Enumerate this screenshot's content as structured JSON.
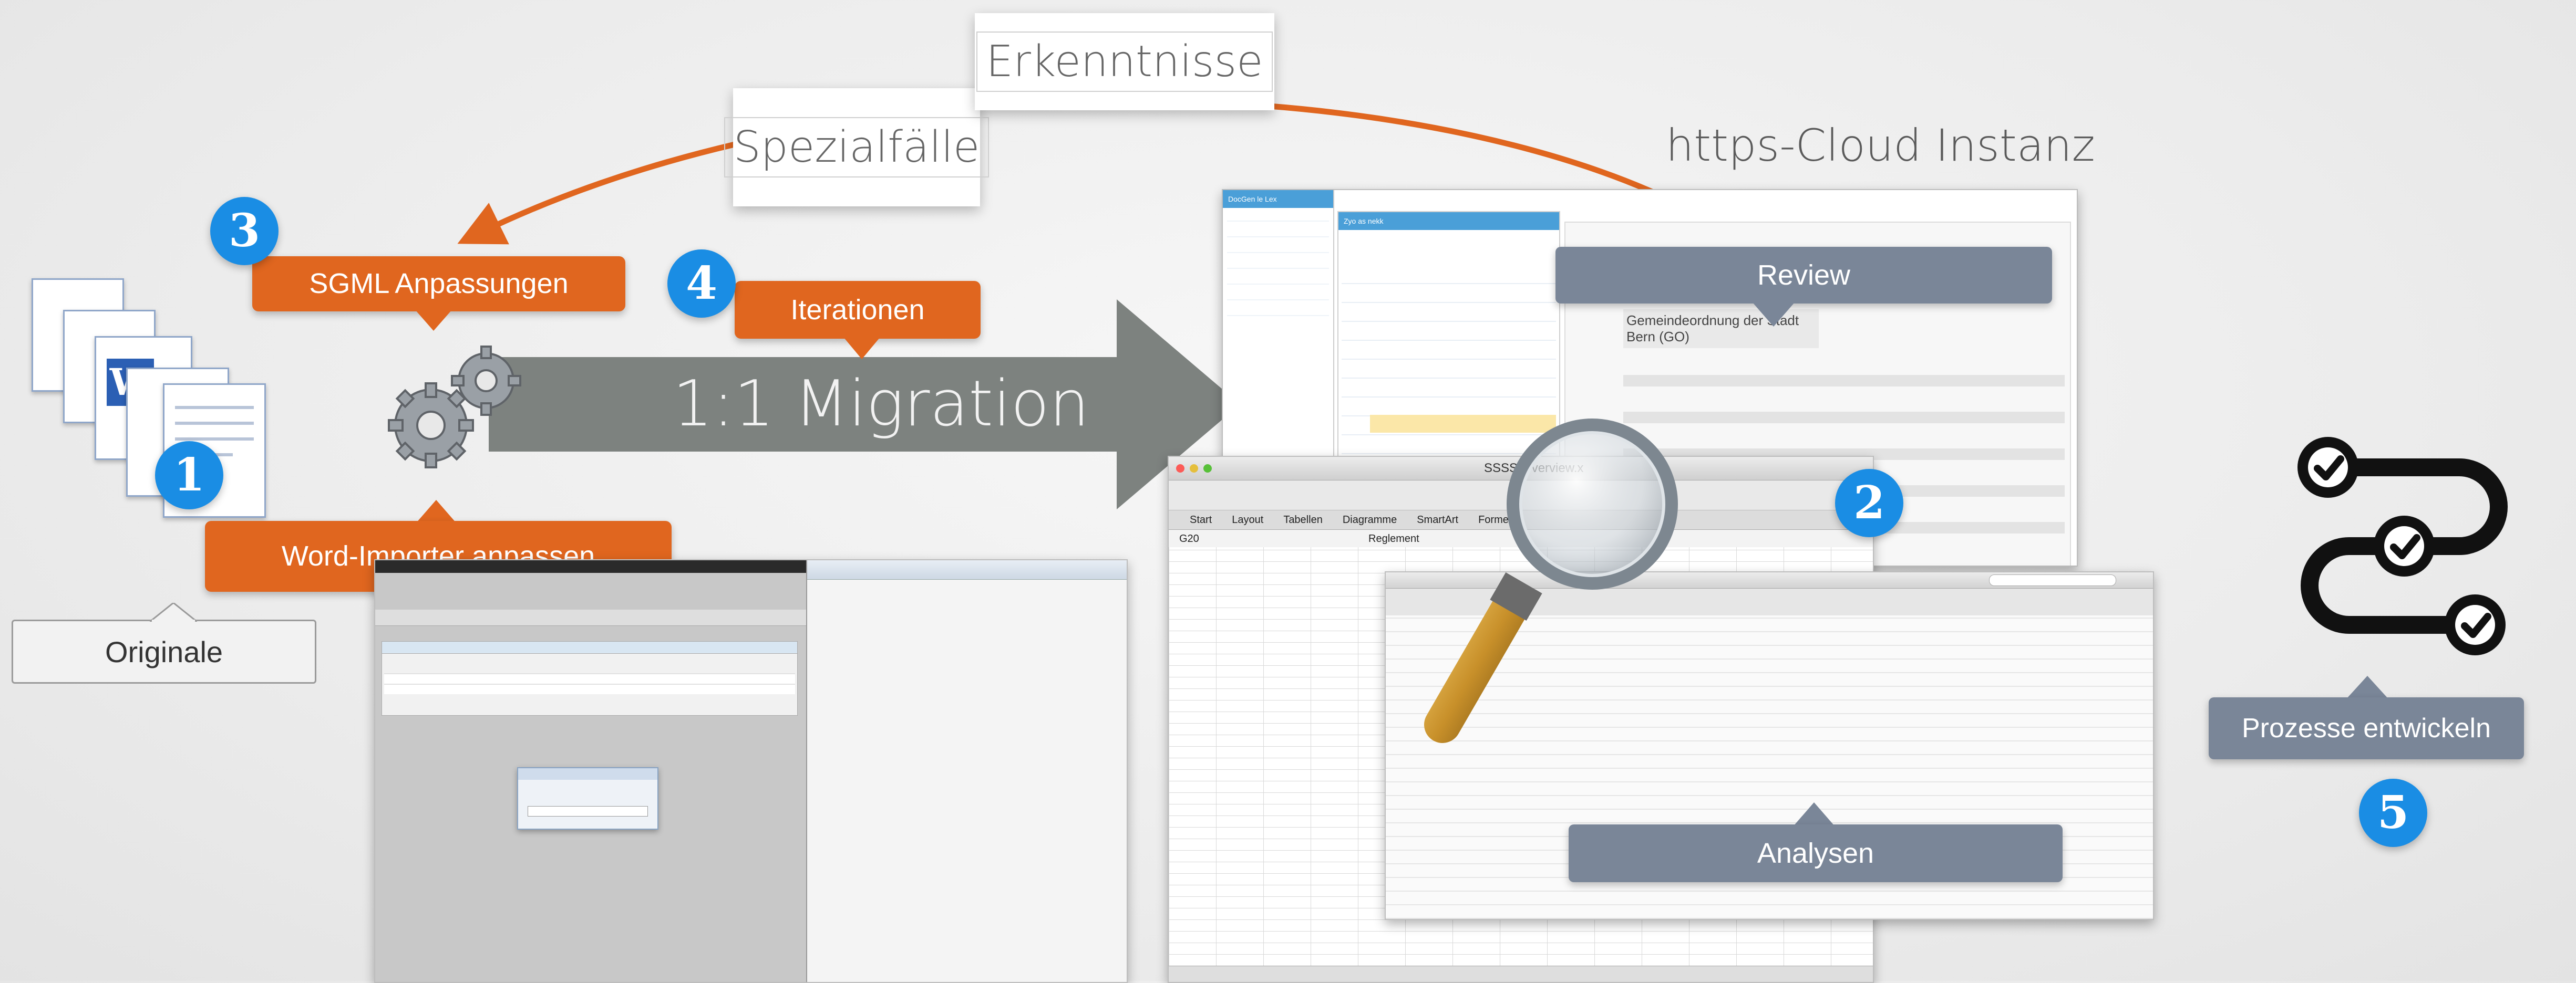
{
  "notes": {
    "erkenntnisse": "Erkenntnisse",
    "spezialfaelle": "Spezialfälle"
  },
  "cloud_title": "https-Cloud Instanz",
  "originale_label": "Originale",
  "migration_label": "1:1 Migration",
  "callouts": {
    "sgml": "SGML Anpassungen",
    "iterationen": "Iterationen",
    "word_importer": "Word-Importer anpassen",
    "review": "Review",
    "analysen": "Analysen",
    "prozesse": "Prozesse entwickeln"
  },
  "badges": {
    "b1": "1",
    "b2": "2",
    "b3": "3",
    "b4": "4",
    "b5": "5"
  },
  "cloud_app": {
    "sidebar_title": "DocGen le Lex",
    "panel_title": "Zyo as nekk",
    "doc_title": "Gemeindeordnung der Stadt Bern (GO)"
  },
  "spreadsheet": {
    "window_title": "SSSS-Overview.x",
    "menu": [
      "Start",
      "Layout",
      "Tabellen",
      "Diagramme",
      "SmartArt",
      "Formeln"
    ],
    "cell_ref": "G20",
    "cell_value": "Reglement"
  },
  "colors": {
    "orange": "#e0661f",
    "slate": "#7a8698",
    "badge_blue": "#1a8de4",
    "arrow_gray": "#7d827f"
  }
}
